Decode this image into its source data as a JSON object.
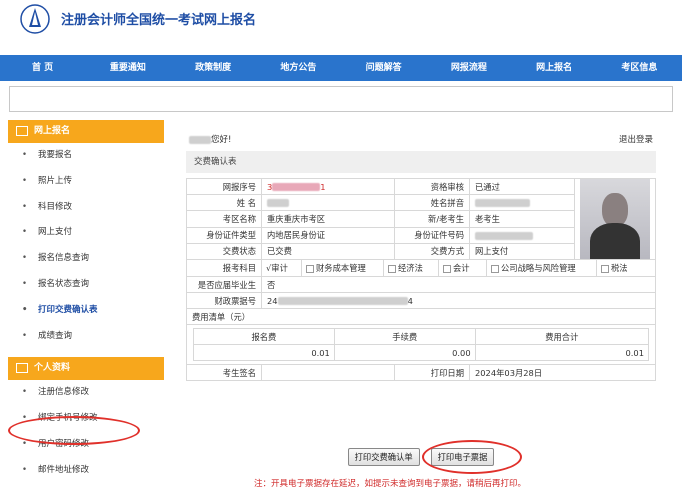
{
  "header": {
    "site_title": "注册会计师全国统一考试网上报名"
  },
  "nav": [
    "首 页",
    "重要通知",
    "政策制度",
    "地方公告",
    "问题解答",
    "网报流程",
    "网上报名",
    "考区信息"
  ],
  "sidebar": {
    "section1_title": "网上报名",
    "items1": [
      "我要报名",
      "照片上传",
      "科目修改",
      "网上支付",
      "报名信息查询",
      "报名状态查询",
      "打印交费确认表",
      "成绩查询"
    ],
    "section2_title": "个人资料",
    "items2": [
      "注册信息修改",
      "绑定手机号修改",
      "用户密码修改",
      "邮件地址修改"
    ]
  },
  "main": {
    "greeting": "您好!",
    "logout": "退出登录",
    "section_title": "交费确认表",
    "labels": {
      "reg_no": "网报序号",
      "qual": "资格审核",
      "name": "姓 名",
      "pinyin": "姓名拼音",
      "exam_area": "考区名称",
      "old_new": "新/老考生",
      "id_type": "身份证件类型",
      "id_no": "身份证件号码",
      "pay_status": "交费状态",
      "pay_method": "交费方式",
      "subjects": "报考科目",
      "graduate": "是否应届毕业生",
      "invoice_no": "财政票据号",
      "fee_list": "费用清单（元）",
      "sign": "考生签名",
      "print_date": "打印日期"
    },
    "values": {
      "reg_no_prefix": "3",
      "reg_no_suffix": "1",
      "qual": "已通过",
      "exam_area": "重庆重庆市考区",
      "old_new": "老考生",
      "id_type": "内地居民身份证",
      "pay_status": "已交费",
      "pay_method": "网上支付",
      "graduate": "否",
      "invoice_prefix": "24",
      "invoice_suffix": "4",
      "print_date": "2024年03月28日"
    },
    "subjects": [
      {
        "mark": "√",
        "label": "审计"
      },
      {
        "mark": "",
        "label": "财务成本管理"
      },
      {
        "mark": "",
        "label": "经济法"
      },
      {
        "mark": "",
        "label": "会计"
      },
      {
        "mark": "",
        "label": "公司战略与风险管理"
      },
      {
        "mark": "",
        "label": "税法"
      }
    ],
    "fees": {
      "headers": [
        "报名费",
        "手续费",
        "费用合计"
      ],
      "values": [
        "0.01",
        "0.00",
        "0.01"
      ]
    },
    "buttons": {
      "print_confirm": "打印交费确认单",
      "print_invoice": "打印电子票据"
    },
    "note": "注：开具电子票据存在延迟，如提示未查询到电子票据，请稍后再打印。"
  }
}
